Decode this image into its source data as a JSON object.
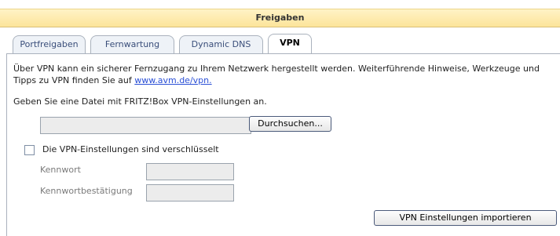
{
  "header": {
    "title": "Freigaben"
  },
  "tabs": [
    {
      "label": "Portfreigaben",
      "active": false
    },
    {
      "label": "Fernwartung",
      "active": false
    },
    {
      "label": "Dynamic DNS",
      "active": false
    },
    {
      "label": "VPN",
      "active": true
    }
  ],
  "content": {
    "intro_text": "Über VPN kann ein sicherer Fernzugang zu Ihrem Netzwerk hergestellt werden. Weiterführende Hinweise, Werkzeuge und Tipps zu VPN finden Sie auf ",
    "intro_link": "www.avm.de/vpn.",
    "file_prompt": "Geben Sie eine Datei mit FRITZ!Box VPN-Einstellungen an.",
    "file_value": "",
    "browse_label": "Durchsuchen...",
    "encrypted_checkbox_label": "Die VPN-Einstellungen sind verschlüsselt",
    "encrypted_checked": false,
    "password_label": "Kennwort",
    "password_value": "",
    "password_confirm_label": "Kennwortbestätigung",
    "password_confirm_value": "",
    "import_label": "VPN Einstellungen importieren"
  }
}
